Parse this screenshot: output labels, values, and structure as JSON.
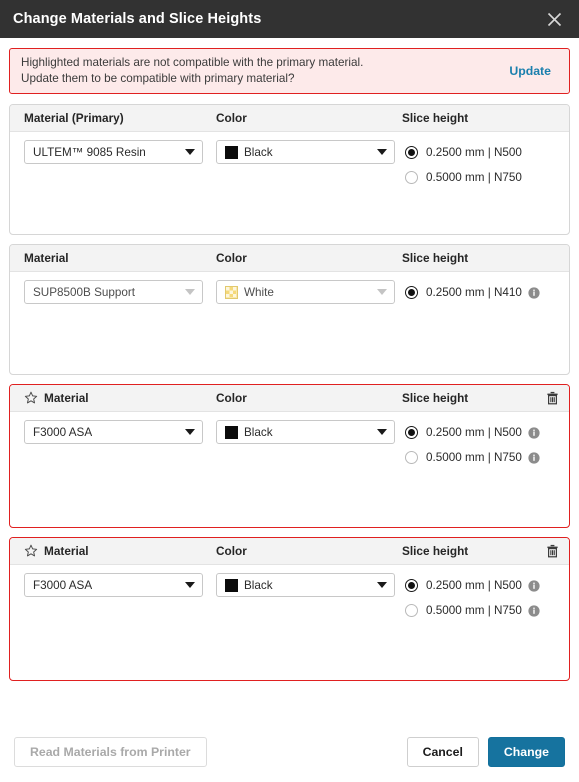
{
  "window": {
    "title": "Change Materials and Slice Heights",
    "close_icon": "close-icon"
  },
  "banner": {
    "line1": "Highlighted materials are not compatible with the primary material.",
    "line2": "Update them to be compatible with primary material?",
    "action_label": "Update",
    "border_color": "#e02020",
    "background_color": "#fdeaea",
    "link_color": "#1a7fad"
  },
  "columns": {
    "material_primary": "Material (Primary)",
    "material": "Material",
    "color": "Color",
    "slice_height": "Slice height"
  },
  "cards": [
    {
      "header_label": "Material (Primary)",
      "color_label": "Color",
      "slice_label": "Slice height",
      "has_star": false,
      "has_trash": false,
      "invalid": false,
      "material": {
        "value": "ULTEM™ 9085 Resin",
        "disabled": false
      },
      "color": {
        "value": "Black",
        "swatch": "black",
        "disabled": false
      },
      "slice_heights": [
        {
          "label": "0.2500 mm | N500",
          "selected": true,
          "info": false
        },
        {
          "label": "0.5000 mm | N750",
          "selected": false,
          "info": false
        }
      ]
    },
    {
      "header_label": "Material",
      "color_label": "Color",
      "slice_label": "Slice height",
      "has_star": false,
      "has_trash": false,
      "invalid": false,
      "material": {
        "value": "SUP8500B Support",
        "disabled": true
      },
      "color": {
        "value": "White",
        "swatch": "white",
        "disabled": true
      },
      "slice_heights": [
        {
          "label": "0.2500 mm | N410",
          "selected": true,
          "info": true
        }
      ]
    },
    {
      "header_label": "Material",
      "color_label": "Color",
      "slice_label": "Slice height",
      "has_star": true,
      "has_trash": true,
      "invalid": true,
      "material": {
        "value": "F3000 ASA",
        "disabled": false
      },
      "color": {
        "value": "Black",
        "swatch": "black",
        "disabled": false
      },
      "slice_heights": [
        {
          "label": "0.2500 mm | N500",
          "selected": true,
          "info": true
        },
        {
          "label": "0.5000 mm | N750",
          "selected": false,
          "info": true
        }
      ]
    },
    {
      "header_label": "Material",
      "color_label": "Color",
      "slice_label": "Slice height",
      "has_star": true,
      "has_trash": true,
      "invalid": true,
      "material": {
        "value": "F3000 ASA",
        "disabled": false
      },
      "color": {
        "value": "Black",
        "swatch": "black",
        "disabled": false
      },
      "slice_heights": [
        {
          "label": "0.2500 mm | N500",
          "selected": true,
          "info": true
        },
        {
          "label": "0.5000 mm | N750",
          "selected": false,
          "info": true
        }
      ]
    }
  ],
  "footer": {
    "read_materials_label": "Read Materials from Printer",
    "read_materials_disabled": true,
    "cancel_label": "Cancel",
    "change_label": "Change",
    "primary_color": "#16739f"
  }
}
